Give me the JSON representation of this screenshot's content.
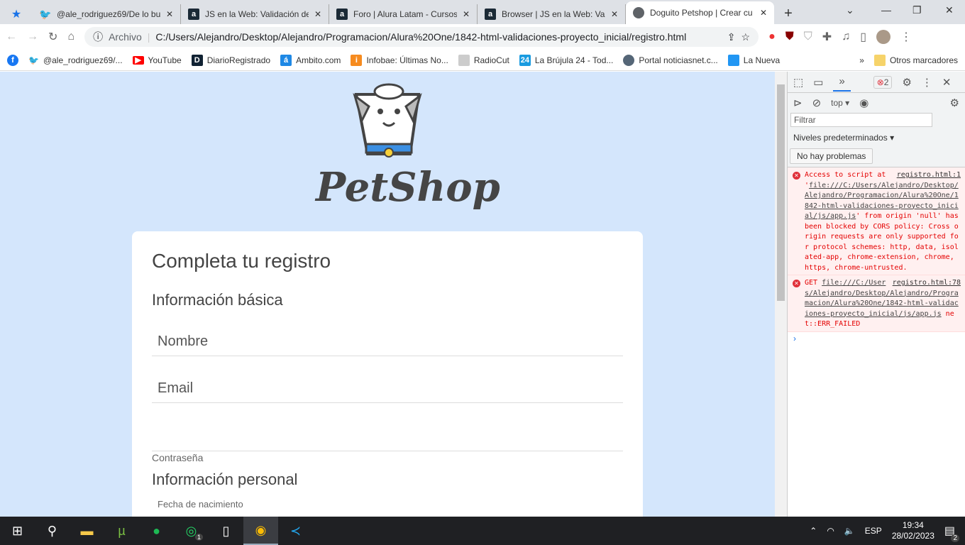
{
  "browser": {
    "tabs": [
      {
        "title": "@ale_rodriguez69/De lo bu",
        "icon": "twitter-icon"
      },
      {
        "title": "JS en la Web: Validación de",
        "icon": "alura-icon"
      },
      {
        "title": "Foro | Alura Latam - Cursos",
        "icon": "alura-icon"
      },
      {
        "title": "Browser | JS en la Web: Vali",
        "icon": "alura-icon"
      },
      {
        "title": "Doguito Petshop | Crear cu",
        "icon": "globe-icon",
        "active": true
      }
    ],
    "address": {
      "scheme": "Archivo",
      "url": "C:/Users/Alejandro/Desktop/Alejandro/Programacion/Alura%20One/1842-html-validaciones-proyecto_inicial/registro.html"
    },
    "bookmarks": [
      "@ale_rodriguez69/...",
      "YouTube",
      "DiarioRegistrado",
      "Ambito.com",
      "Infobae: Últimas No...",
      "RadioCut",
      "La Brújula 24 - Tod...",
      "Portal noticiasnet.c...",
      "La Nueva"
    ],
    "bookmarks_more": "»",
    "other_bookmarks": "Otros marcadores"
  },
  "page": {
    "brand": "PetShop",
    "title": "Completa tu registro",
    "section_basic": "Información básica",
    "name_placeholder": "Nombre",
    "email_placeholder": "Email",
    "password_label": "Contraseña",
    "section_personal": "Información personal",
    "birth_label": "Fecha de nacimiento",
    "colors": {
      "background": "#d4e6fc",
      "card": "#ffffff",
      "text": "#444444"
    }
  },
  "devtools": {
    "error_count": "2",
    "context": "top",
    "filter_placeholder": "Filtrar",
    "levels": "Niveles predeterminados",
    "issues": "No hay problemas",
    "messages": [
      {
        "source": "registro.html:1",
        "pre": "Access to script at '",
        "link": "file:///C:/Users/Alejandro/Desktop/Alejandro/Programacion/Alura%20One/1842-html-validaciones-proyecto_inicial/js/app.js",
        "post": "' from origin 'null' has been blocked by CORS policy: Cross origin requests are only supported for protocol schemes: http, data, isolated-app, chrome-extension, chrome, https, chrome-untrusted."
      },
      {
        "source": "registro.html:78",
        "pre": "GET ",
        "link": "file:///C:/Users/Alejandro/Desktop/Alejandro/Programacion/Alura%20One/1842-html-validaciones-proyecto_inicial/js/app.js",
        "post": " net::ERR_FAILED"
      }
    ],
    "error_color": "#e40000"
  },
  "taskbar": {
    "lang": "ESP",
    "time": "19:34",
    "date": "28/02/2023",
    "notifications": "2",
    "whatsapp_badge": "1"
  }
}
